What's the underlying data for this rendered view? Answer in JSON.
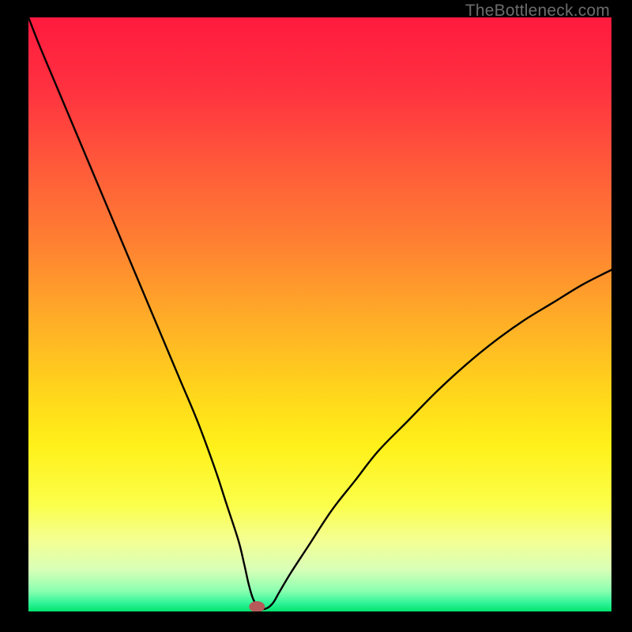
{
  "watermark": "TheBottleneck.com",
  "chart_data": {
    "type": "line",
    "title": "",
    "xlabel": "",
    "ylabel": "",
    "xlim": [
      0,
      100
    ],
    "ylim": [
      0,
      100
    ],
    "grid": false,
    "legend": false,
    "background_gradient": {
      "stops": [
        {
          "offset": 0.0,
          "color": "#ff1a3e"
        },
        {
          "offset": 0.12,
          "color": "#ff3140"
        },
        {
          "offset": 0.25,
          "color": "#ff5a3a"
        },
        {
          "offset": 0.38,
          "color": "#ff8032"
        },
        {
          "offset": 0.5,
          "color": "#ffaa28"
        },
        {
          "offset": 0.62,
          "color": "#ffd21c"
        },
        {
          "offset": 0.72,
          "color": "#fff019"
        },
        {
          "offset": 0.82,
          "color": "#fbff4a"
        },
        {
          "offset": 0.88,
          "color": "#f4ff92"
        },
        {
          "offset": 0.93,
          "color": "#d8ffb8"
        },
        {
          "offset": 0.965,
          "color": "#8cffb0"
        },
        {
          "offset": 0.985,
          "color": "#34f59a"
        },
        {
          "offset": 1.0,
          "color": "#00e36f"
        }
      ]
    },
    "series": [
      {
        "name": "bottleneck-curve",
        "color": "#000000",
        "stroke_width": 2.4,
        "x": [
          0,
          2,
          5,
          8,
          11,
          14,
          17,
          20,
          23,
          26,
          29,
          32,
          34,
          36,
          37,
          37.8,
          38.5,
          39.2,
          40,
          41,
          42,
          43,
          45,
          48,
          52,
          56,
          60,
          65,
          70,
          75,
          80,
          85,
          90,
          95,
          100
        ],
        "y": [
          100,
          95,
          88,
          81,
          74,
          67,
          60,
          53,
          46,
          39,
          32,
          24,
          18,
          12,
          8,
          4.5,
          2.2,
          1.0,
          0.4,
          0.6,
          1.5,
          3.2,
          6.5,
          11,
          17,
          22,
          27,
          32,
          37,
          41.5,
          45.5,
          49,
          52,
          55,
          57.5
        ]
      }
    ],
    "marker": {
      "name": "optimum-marker",
      "x": 39.2,
      "y": 0.8,
      "color": "#b75a5a",
      "rx": 10,
      "ry": 7
    }
  }
}
